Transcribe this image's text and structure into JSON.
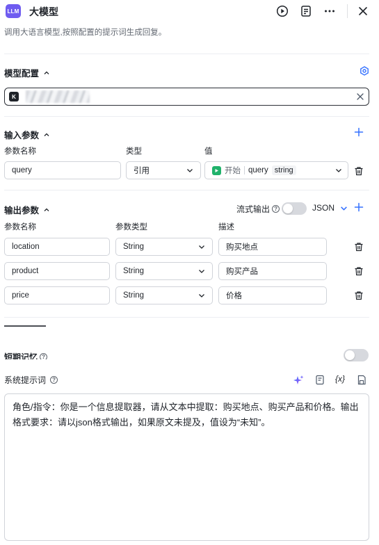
{
  "header": {
    "logo_text": "LLM",
    "title": "大模型",
    "description": "调用大语言模型,按照配置的提示词生成回复。"
  },
  "model_config": {
    "title": "模型配置",
    "model_badge": "K"
  },
  "input_params": {
    "title": "输入参数",
    "col_name": "参数名称",
    "col_type": "类型",
    "col_value": "值",
    "rows": [
      {
        "name": "query",
        "type": "引用",
        "ref_node": "开始",
        "ref_var": "query",
        "ref_type": "string"
      }
    ]
  },
  "output_params": {
    "title": "输出参数",
    "stream_label": "流式输出",
    "format": "JSON",
    "col_name": "参数名称",
    "col_type": "参数类型",
    "col_desc": "描述",
    "rows": [
      {
        "name": "location",
        "type": "String",
        "desc": "购买地点"
      },
      {
        "name": "product",
        "type": "String",
        "desc": "购买产品"
      },
      {
        "name": "price",
        "type": "String",
        "desc": "价格"
      }
    ]
  },
  "memory": {
    "label": "短期记忆"
  },
  "system_prompt": {
    "label": "系统提示词",
    "variable_icon_text": "{x}",
    "content": "角色/指令：你是一个信息提取器，请从文本中提取：购买地点、购买产品和价格。输出格式要求：请以json格式输出，如果原文未提及，值设为“未知”。"
  },
  "colors": {
    "accent": "#3370ff",
    "logo": "#6f5cf0",
    "start_node": "#20b26b",
    "border": "#d0d3d9"
  }
}
